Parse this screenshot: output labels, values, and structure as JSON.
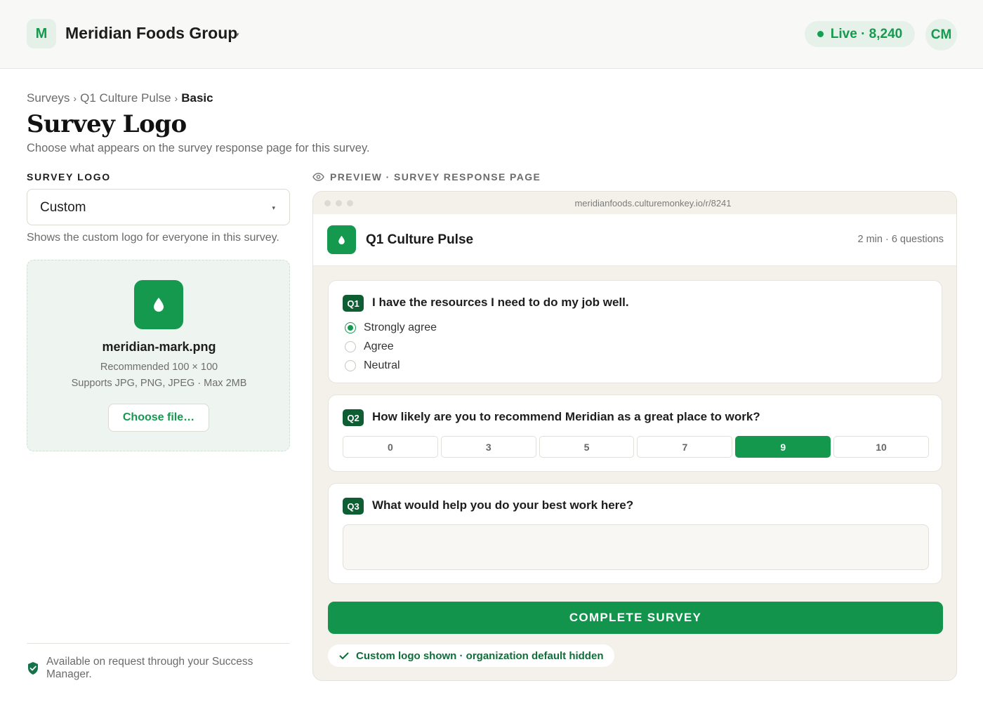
{
  "header": {
    "org_initial": "M",
    "org_name": "Meridian Foods Group",
    "org_caret": "▾",
    "live_label": "Live · 8,240",
    "user_initials": "CM"
  },
  "breadcrumb": {
    "items": [
      "Surveys",
      "Q1 Culture Pulse"
    ],
    "current": "Basic",
    "separator": "›"
  },
  "page": {
    "title": "Survey Logo",
    "subtitle": "Choose what appears on the survey response page for this survey."
  },
  "logo_settings": {
    "section_label": "SURVEY LOGO",
    "select_value": "Custom",
    "select_caret": "▾",
    "select_hint": "Shows the custom logo for everyone in this survey.",
    "file_name": "meridian-mark.png",
    "recommended": "Recommended 100 × 100",
    "supports": "Supports JPG, PNG, JPEG · Max 2MB",
    "choose_label": "Choose file…",
    "footer_note": "Available on request through your Success Manager."
  },
  "preview": {
    "label": "PREVIEW · SURVEY RESPONSE PAGE",
    "url": "meridianfoods.culturemonkey.io/r/8241",
    "survey_title": "Q1 Culture Pulse",
    "survey_meta": "2 min · 6 questions",
    "questions": [
      {
        "badge": "Q1",
        "text": "I have the resources I need to do my job well.",
        "options": [
          "Strongly agree",
          "Agree",
          "Neutral"
        ],
        "selected": "Strongly agree"
      },
      {
        "badge": "Q2",
        "text": "How likely are you to recommend Meridian as a great place to work?",
        "scale": [
          "0",
          "3",
          "5",
          "7",
          "9",
          "10"
        ],
        "selected": "9"
      },
      {
        "badge": "Q3",
        "text": "What would help you do your best work here?"
      }
    ],
    "complete_label": "COMPLETE SURVEY",
    "status_label": "Custom logo shown · organization default hidden"
  },
  "colors": {
    "brand_green": "#15994f",
    "dark_green": "#0f5e33",
    "preview_bg": "#f4f1ea"
  },
  "icons": {
    "logo": "droplet-icon",
    "eye": "eye-icon",
    "shield": "shield-check-icon",
    "check": "check-icon"
  }
}
